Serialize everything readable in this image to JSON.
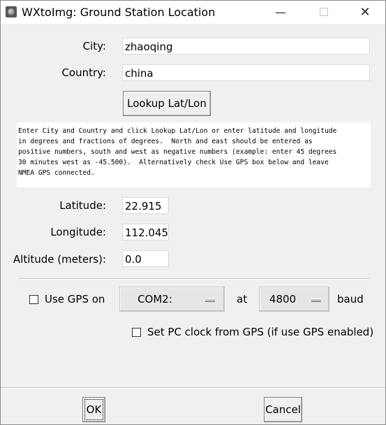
{
  "window": {
    "title": "WXtoImg: Ground Station Location",
    "controls": [
      "minimize-icon",
      "maximize-icon",
      "close-icon"
    ]
  },
  "location": {
    "city_label": "City:",
    "city_value": "zhaoqing",
    "country_label": "Country:",
    "country_value": "china",
    "lookup_button": "Lookup Lat/Lon",
    "info_text": "Enter City and Country and click Lookup Lat/Lon or enter latitude and longitude\nin degrees and fractions of degrees.  North and east should be entered as\npositive numbers, south and west as negative numbers (example: enter 45 degrees\n30 minutes west as -45.500).  Alternatively check Use GPS box below and leave\nNMEA GPS connected.",
    "latitude_label": "Latitude:",
    "latitude_value": "22.915",
    "longitude_label": "Longitude:",
    "longitude_value": "112.045",
    "altitude_label": "Altitude (meters):",
    "altitude_value": "0.0"
  },
  "gps": {
    "use_gps_label": "Use GPS on",
    "use_gps_checked": false,
    "port_value": "COM2:",
    "at_label": "at",
    "baud_value": "4800",
    "baud_label": "baud",
    "set_clock_label": "Set PC clock from GPS (if use GPS enabled)",
    "set_clock_checked": false
  },
  "footer": {
    "ok_label": "OK",
    "cancel_label": "Cancel"
  }
}
